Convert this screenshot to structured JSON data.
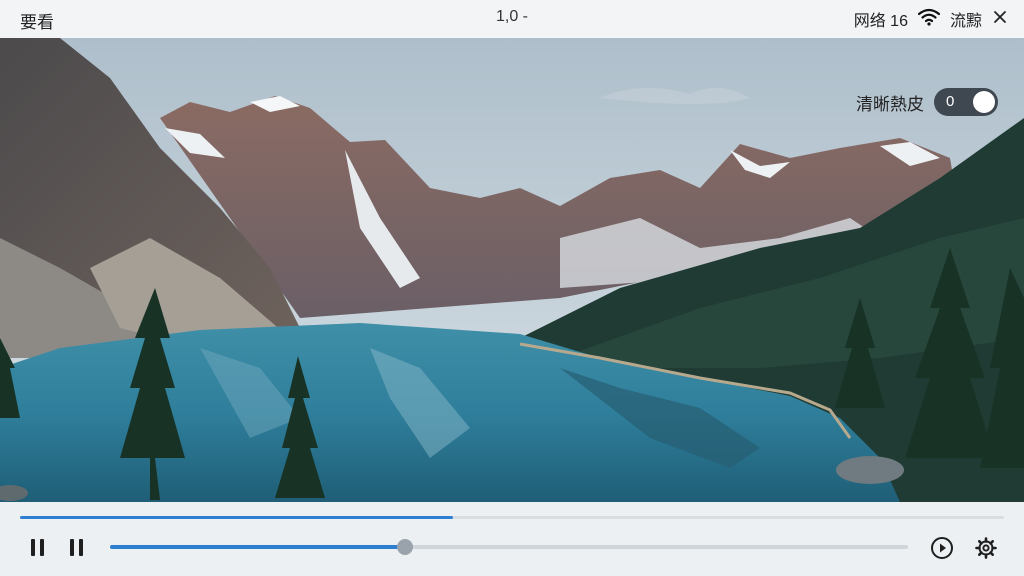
{
  "app": {
    "title": "要看"
  },
  "header": {
    "center_text": "1,0 -"
  },
  "status": {
    "network_label": "网络 16",
    "mode_label": "流黥",
    "wifi_icon": "wifi-icon",
    "close_icon": "close-icon"
  },
  "quality": {
    "label": "清晰熱皮",
    "toggle_text": "0"
  },
  "playback": {
    "buffer_progress": 0.44,
    "seek_progress": 0.37
  },
  "controls": {
    "play_icon": "play-circle-icon",
    "settings_icon": "gear-icon"
  },
  "colors": {
    "accent": "#2f7fd1",
    "toggle": "#3f4851",
    "topbar": "#f3f4f6"
  }
}
